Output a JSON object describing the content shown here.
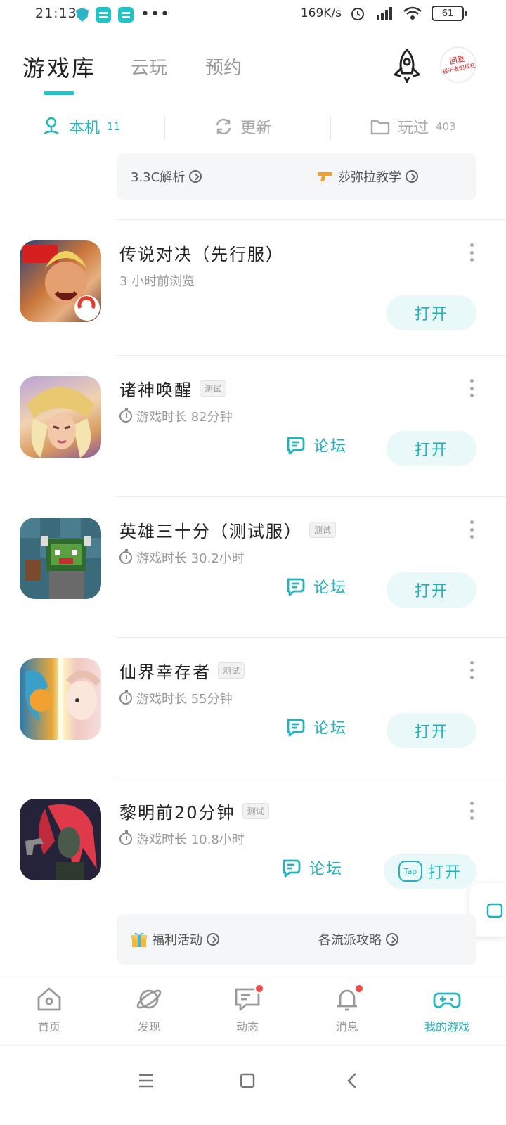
{
  "status_bar": {
    "time": "21:13",
    "network_speed": "169K/s",
    "battery": "61"
  },
  "header": {
    "tabs": [
      {
        "label": "游戏库",
        "active": true
      },
      {
        "label": "云玩",
        "active": false
      },
      {
        "label": "预约",
        "active": false
      }
    ],
    "avatar_text_top": "回复",
    "avatar_text_bottom": "轻不去的现在"
  },
  "subtabs": [
    {
      "label": "本机",
      "count": "11",
      "icon": "user-pin-icon",
      "active": true
    },
    {
      "label": "更新",
      "count": "",
      "icon": "refresh-icon",
      "active": false
    },
    {
      "label": "玩过",
      "count": "403",
      "icon": "folder-icon",
      "active": false
    }
  ],
  "top_strip": {
    "left": "3.3C解析",
    "right": "莎弥拉教学"
  },
  "games": [
    {
      "title": "传说对决（先行服）",
      "badge": "",
      "subtitle": "3 小时前浏览",
      "has_timer": false,
      "forum": "",
      "open": "打开"
    },
    {
      "title": "诸神唤醒",
      "badge": "测试",
      "subtitle": "游戏时长  82分钟",
      "has_timer": true,
      "forum": "论坛",
      "open": "打开"
    },
    {
      "title": "英雄三十分（测试服）",
      "badge": "测试",
      "subtitle": "游戏时长  30.2小时",
      "has_timer": true,
      "forum": "论坛",
      "open": "打开"
    },
    {
      "title": "仙界幸存者",
      "badge": "测试",
      "subtitle": "游戏时长  55分钟",
      "has_timer": true,
      "forum": "论坛",
      "open": "打开"
    },
    {
      "title": "黎明前20分钟",
      "badge": "测试",
      "subtitle": "游戏时长  10.8小时",
      "has_timer": true,
      "forum": "论坛",
      "open": "打开",
      "tap_label": "Tap"
    }
  ],
  "bottom_strip": {
    "left": "福利活动",
    "right": "各流派攻略"
  },
  "bottom_nav": [
    {
      "label": "首页",
      "icon": "home-icon",
      "active": false
    },
    {
      "label": "发现",
      "icon": "planet-icon",
      "active": false
    },
    {
      "label": "动态",
      "icon": "chat-icon",
      "active": false,
      "dot": true
    },
    {
      "label": "消息",
      "icon": "bell-icon",
      "active": false,
      "dot": true
    },
    {
      "label": "我的游戏",
      "icon": "gamepad-icon",
      "active": true
    }
  ],
  "colors": {
    "accent": "#1fb9c0",
    "button_bg": "#e9f8f8",
    "badge_red": "#f24a4a"
  }
}
